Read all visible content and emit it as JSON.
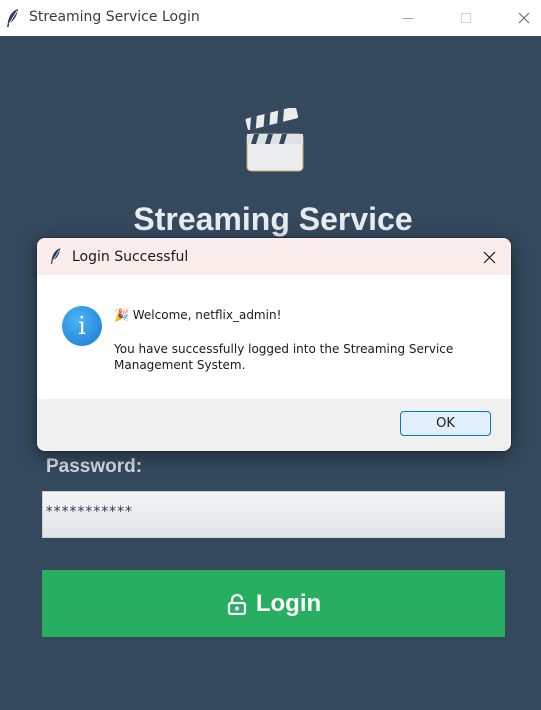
{
  "window": {
    "title": "Streaming Service Login",
    "app_icon": "feather-icon",
    "controls": [
      "minimize-icon",
      "maximize-icon",
      "close-icon"
    ]
  },
  "app": {
    "logo_icon": "clapperboard-icon",
    "heading": "Streaming Service",
    "password_label": "Password:",
    "password_value": "***********",
    "login_button_icon": "lock-icon",
    "login_button_label": "Login",
    "colors": {
      "background": "#34495e",
      "login_button": "#27ae60"
    }
  },
  "dialog": {
    "title": "Login Successful",
    "app_icon": "feather-icon",
    "icon": "info-icon",
    "welcome_line": "🎉 Welcome, netflix_admin!",
    "message": "You have successfully logged into the Streaming Service Management System.",
    "ok_label": "OK",
    "colors": {
      "titlebar": "#f9eceb",
      "ok_border": "#0078d4"
    }
  }
}
